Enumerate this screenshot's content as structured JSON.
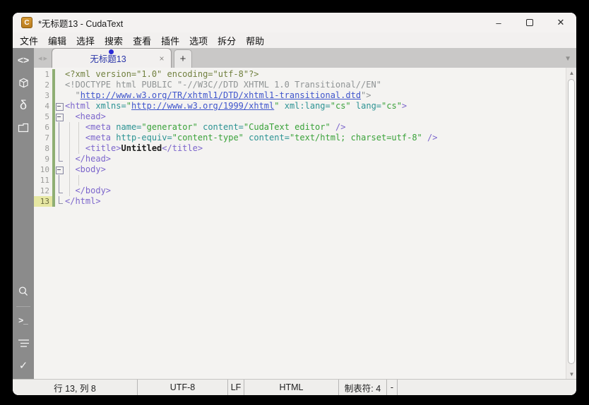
{
  "window": {
    "title": "*无标题13 - CudaText",
    "app_icon_letter": "C"
  },
  "titlebar_icons": {
    "minimize": "–",
    "close": "✕"
  },
  "menu": {
    "items": [
      "文件",
      "编辑",
      "选择",
      "搜索",
      "查看",
      "插件",
      "选项",
      "拆分",
      "帮助"
    ]
  },
  "tabbar": {
    "nav_left": "◂",
    "nav_right": "▸",
    "active_tab_label": "无标题13",
    "tab_close": "×",
    "new_tab": "+",
    "tab_list_arrow": "▼"
  },
  "sidebar": {
    "icon_glyphs": {
      "code": "<>",
      "delta": "δ",
      "terminal": ">_",
      "check": "✓"
    },
    "icon_names": [
      "code-icon",
      "package-icon",
      "delta-icon",
      "folder-icon",
      "search-icon",
      "terminal-icon",
      "list-icon",
      "check-icon"
    ]
  },
  "editor": {
    "lines": [
      {
        "num": "1",
        "fold": "",
        "current": false,
        "guides": [],
        "segs": [
          [
            "pi",
            "<?xml version=\"1.0\" encoding=\"utf-8\"?>"
          ]
        ]
      },
      {
        "num": "2",
        "fold": "",
        "current": false,
        "guides": [],
        "segs": [
          [
            "gray",
            "<!DOCTYPE html PUBLIC \"-//W3C//DTD XHTML 1.0 Transitional//EN\""
          ]
        ]
      },
      {
        "num": "3",
        "fold": "",
        "current": false,
        "guides": [],
        "segs": [
          [
            "gray",
            "  \""
          ],
          [
            "link",
            "http://www.w3.org/TR/xhtml1/DTD/xhtml1-transitional.dtd"
          ],
          [
            "gray",
            "\">"
          ]
        ]
      },
      {
        "num": "4",
        "fold": "box",
        "current": false,
        "guides": [],
        "segs": [
          [
            "tag",
            "<html"
          ],
          [
            "plain",
            " "
          ],
          [
            "attr",
            "xmlns="
          ],
          [
            "val",
            "\""
          ],
          [
            "link",
            "http://www.w3.org/1999/xhtml"
          ],
          [
            "val",
            "\""
          ],
          [
            "plain",
            " "
          ],
          [
            "attr",
            "xml:lang="
          ],
          [
            "val",
            "\"cs\""
          ],
          [
            "plain",
            " "
          ],
          [
            "attr",
            "lang="
          ],
          [
            "val",
            "\"cs\""
          ],
          [
            "tag",
            ">"
          ]
        ]
      },
      {
        "num": "5",
        "fold": "box",
        "current": false,
        "guides": [],
        "segs": [
          [
            "plain",
            "  "
          ],
          [
            "tag",
            "<head>"
          ]
        ]
      },
      {
        "num": "6",
        "fold": "vline",
        "current": false,
        "guides": [
          8,
          21
        ],
        "segs": [
          [
            "plain",
            "    "
          ],
          [
            "tag",
            "<meta"
          ],
          [
            "plain",
            " "
          ],
          [
            "attr",
            "name="
          ],
          [
            "val",
            "\"generator\""
          ],
          [
            "plain",
            " "
          ],
          [
            "attr",
            "content="
          ],
          [
            "val",
            "\"CudaText editor\""
          ],
          [
            "plain",
            " "
          ],
          [
            "tag",
            "/>"
          ]
        ]
      },
      {
        "num": "7",
        "fold": "vline",
        "current": false,
        "guides": [
          8,
          21
        ],
        "segs": [
          [
            "plain",
            "    "
          ],
          [
            "tag",
            "<meta"
          ],
          [
            "plain",
            " "
          ],
          [
            "attr",
            "http-equiv="
          ],
          [
            "val",
            "\"content-type\""
          ],
          [
            "plain",
            " "
          ],
          [
            "attr",
            "content="
          ],
          [
            "val",
            "\"text/html; charset=utf-8\""
          ],
          [
            "plain",
            " "
          ],
          [
            "tag",
            "/>"
          ]
        ]
      },
      {
        "num": "8",
        "fold": "vline",
        "current": false,
        "guides": [
          8,
          21
        ],
        "segs": [
          [
            "plain",
            "    "
          ],
          [
            "tag",
            "<title>"
          ],
          [
            "text",
            "Untitled"
          ],
          [
            "tag",
            "</title>"
          ]
        ]
      },
      {
        "num": "9",
        "fold": "end",
        "current": false,
        "guides": [
          8
        ],
        "segs": [
          [
            "plain",
            "  "
          ],
          [
            "tag",
            "</head>"
          ]
        ]
      },
      {
        "num": "10",
        "fold": "box",
        "current": false,
        "guides": [
          8
        ],
        "segs": [
          [
            "plain",
            "  "
          ],
          [
            "tag",
            "<body>"
          ]
        ]
      },
      {
        "num": "11",
        "fold": "vline",
        "current": false,
        "guides": [
          8,
          21
        ],
        "segs": []
      },
      {
        "num": "12",
        "fold": "end",
        "current": false,
        "guides": [
          8
        ],
        "segs": [
          [
            "plain",
            "  "
          ],
          [
            "tag",
            "</body>"
          ]
        ]
      },
      {
        "num": "13",
        "fold": "end",
        "current": true,
        "guides": [],
        "segs": [
          [
            "tag",
            "</html>"
          ]
        ]
      }
    ]
  },
  "statusbar": {
    "cells": [
      "行 13, 列 8",
      "UTF-8",
      "LF",
      "HTML",
      "制表符: 4",
      "-"
    ]
  },
  "colors": {
    "syntax_tag": "#7c66cc",
    "syntax_attr": "#2c9393",
    "syntax_value": "#3aa23a",
    "syntax_link": "#3f55cc",
    "syntax_comment": "#8f9394",
    "syntax_pi": "#71803f",
    "modified_tab_text": "#2a35a8",
    "modified_dot": "#2b2bd5",
    "change_bar": "#8fae74",
    "current_line_gutter": "#e6e7a2",
    "sidebar_bg": "#8b8b8b",
    "app_icon_bg": "#c98a2e"
  }
}
